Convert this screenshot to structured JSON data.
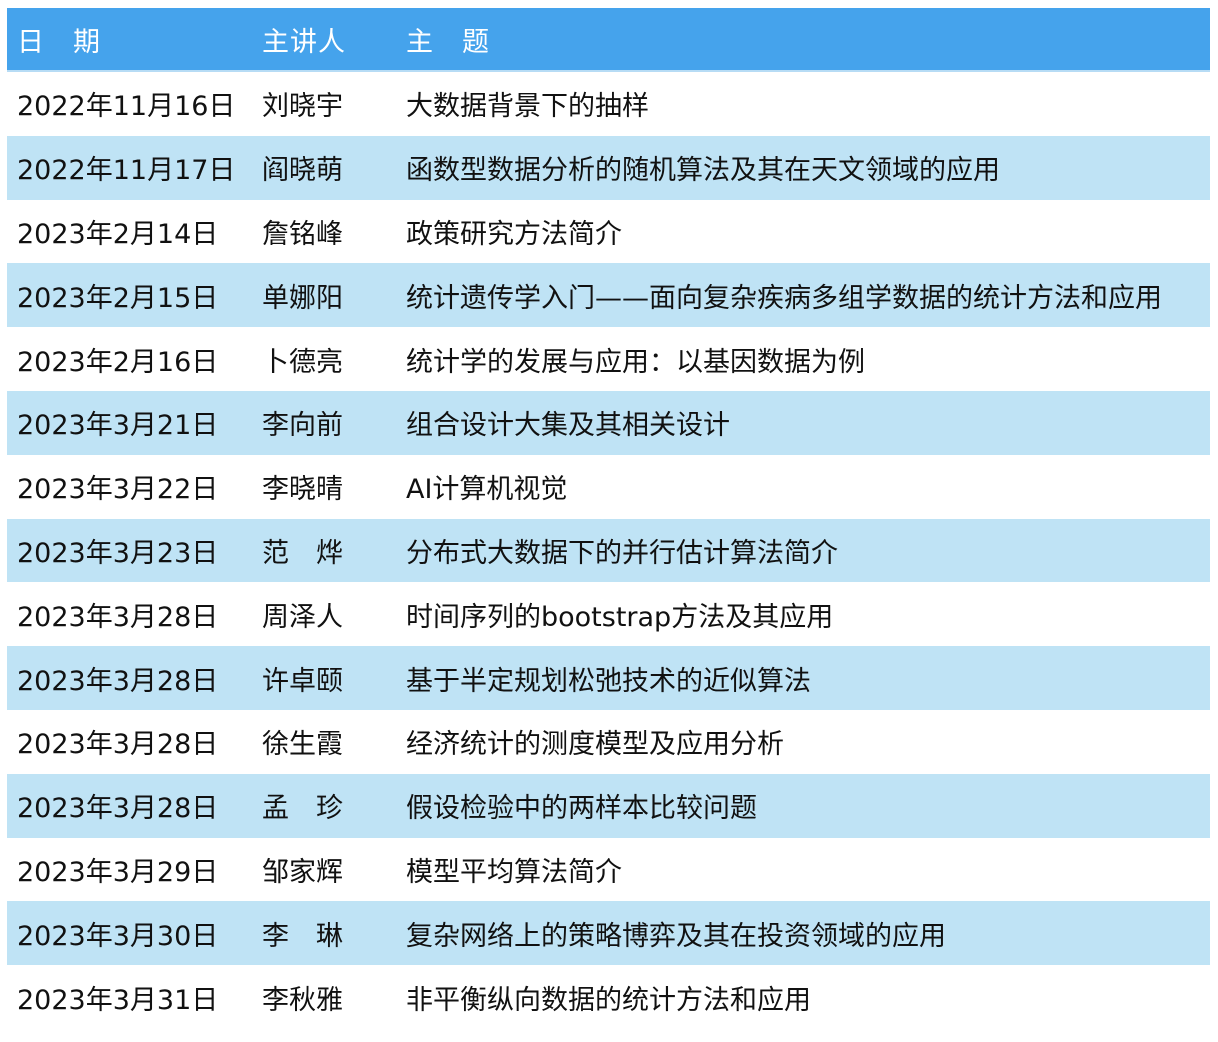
{
  "table": {
    "header": {
      "date": "日　期",
      "speaker": "主讲人",
      "topic": "主　题"
    },
    "rows": [
      {
        "date": "2022年11月16日",
        "speaker": "刘晓宇",
        "topic": "大数据背景下的抽样"
      },
      {
        "date": "2022年11月17日",
        "speaker": "阎晓萌",
        "topic": "函数型数据分析的随机算法及其在天文领域的应用"
      },
      {
        "date": "2023年2月14日",
        "speaker": "詹铭峰",
        "topic": "政策研究方法简介"
      },
      {
        "date": "2023年2月15日",
        "speaker": "单娜阳",
        "topic": "统计遗传学入门——面向复杂疾病多组学数据的统计方法和应用"
      },
      {
        "date": "2023年2月16日",
        "speaker": "卜德亮",
        "topic": "统计学的发展与应用：以基因数据为例"
      },
      {
        "date": "2023年3月21日",
        "speaker": "李向前",
        "topic": "组合设计大集及其相关设计"
      },
      {
        "date": "2023年3月22日",
        "speaker": "李晓晴",
        "topic": "AI计算机视觉"
      },
      {
        "date": "2023年3月23日",
        "speaker": "范　烨",
        "topic": "分布式大数据下的并行估计算法简介"
      },
      {
        "date": "2023年3月28日",
        "speaker": "周泽人",
        "topic": "时间序列的bootstrap方法及其应用"
      },
      {
        "date": "2023年3月28日",
        "speaker": "许卓颐",
        "topic": "基于半定规划松弛技术的近似算法"
      },
      {
        "date": "2023年3月28日",
        "speaker": "徐生霞",
        "topic": "经济统计的测度模型及应用分析"
      },
      {
        "date": "2023年3月28日",
        "speaker": "孟　珍",
        "topic": "假设检验中的两样本比较问题"
      },
      {
        "date": "2023年3月29日",
        "speaker": "邹家辉",
        "topic": "模型平均算法简介"
      },
      {
        "date": "2023年3月30日",
        "speaker": "李　琳",
        "topic": "复杂网络上的策略博弈及其在投资领域的应用"
      },
      {
        "date": "2023年3月31日",
        "speaker": "李秋雅",
        "topic": "非平衡纵向数据的统计方法和应用"
      }
    ]
  },
  "colors": {
    "header_bg": "#45a3ec",
    "stripe_bg": "#bfe3f5",
    "text": "#111111",
    "header_text": "#ffffff"
  }
}
